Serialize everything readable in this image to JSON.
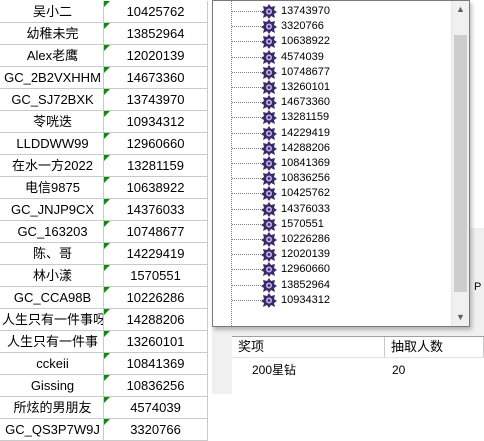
{
  "sheet": {
    "rows": [
      {
        "name": "吴小二",
        "num": "10425762"
      },
      {
        "name": "幼稚未完",
        "num": "13852964"
      },
      {
        "name": "Alex老鹰",
        "num": "12020139"
      },
      {
        "name": "GC_2B2VXHHM",
        "num": "14673360"
      },
      {
        "name": "GC_SJ72BXK",
        "num": "13743970"
      },
      {
        "name": "苓咣迭",
        "num": "10934312"
      },
      {
        "name": "LLDDWW99",
        "num": "12960660"
      },
      {
        "name": "在水一方2022",
        "num": "13281159"
      },
      {
        "name": "电信9875",
        "num": "10638922"
      },
      {
        "name": "GC_JNJP9CX",
        "num": "14376033"
      },
      {
        "name": "GC_163203",
        "num": "10748677"
      },
      {
        "name": "陈、哥",
        "num": "14229419"
      },
      {
        "name": "林小漾",
        "num": "1570551"
      },
      {
        "name": "GC_CCA98B",
        "num": "10226286"
      },
      {
        "name": "人生只有一件事呀",
        "num": "14288206"
      },
      {
        "name": "人生只有一件事",
        "num": "13260101"
      },
      {
        "name": "cckeii",
        "num": "10841369"
      },
      {
        "name": "Gissing",
        "num": "10836256"
      },
      {
        "name": "所炫的男朋友",
        "num": "4574039"
      },
      {
        "name": "GC_QS3P7W9J",
        "num": "3320766"
      }
    ]
  },
  "tree": {
    "items": [
      "13743970",
      "3320766",
      "10638922",
      "4574039",
      "10748677",
      "13260101",
      "14673360",
      "13281159",
      "14229419",
      "14288206",
      "10841369",
      "10836256",
      "10425762",
      "14376033",
      "1570551",
      "10226286",
      "12020139",
      "12960660",
      "13852964",
      "10934312"
    ],
    "scroll_up_glyph": "▲",
    "scroll_down_glyph": "▼"
  },
  "prize_table": {
    "headers": [
      "奖项",
      "抽取人数"
    ],
    "rows": [
      {
        "prize": "200星钻",
        "count": "20"
      }
    ]
  },
  "colors": {
    "cell_marker": "#108a10",
    "node_icon_dark": "#3a2a6a",
    "node_icon_light": "#c9b6e8"
  },
  "icons": {
    "tree_node": "badge-icon"
  }
}
